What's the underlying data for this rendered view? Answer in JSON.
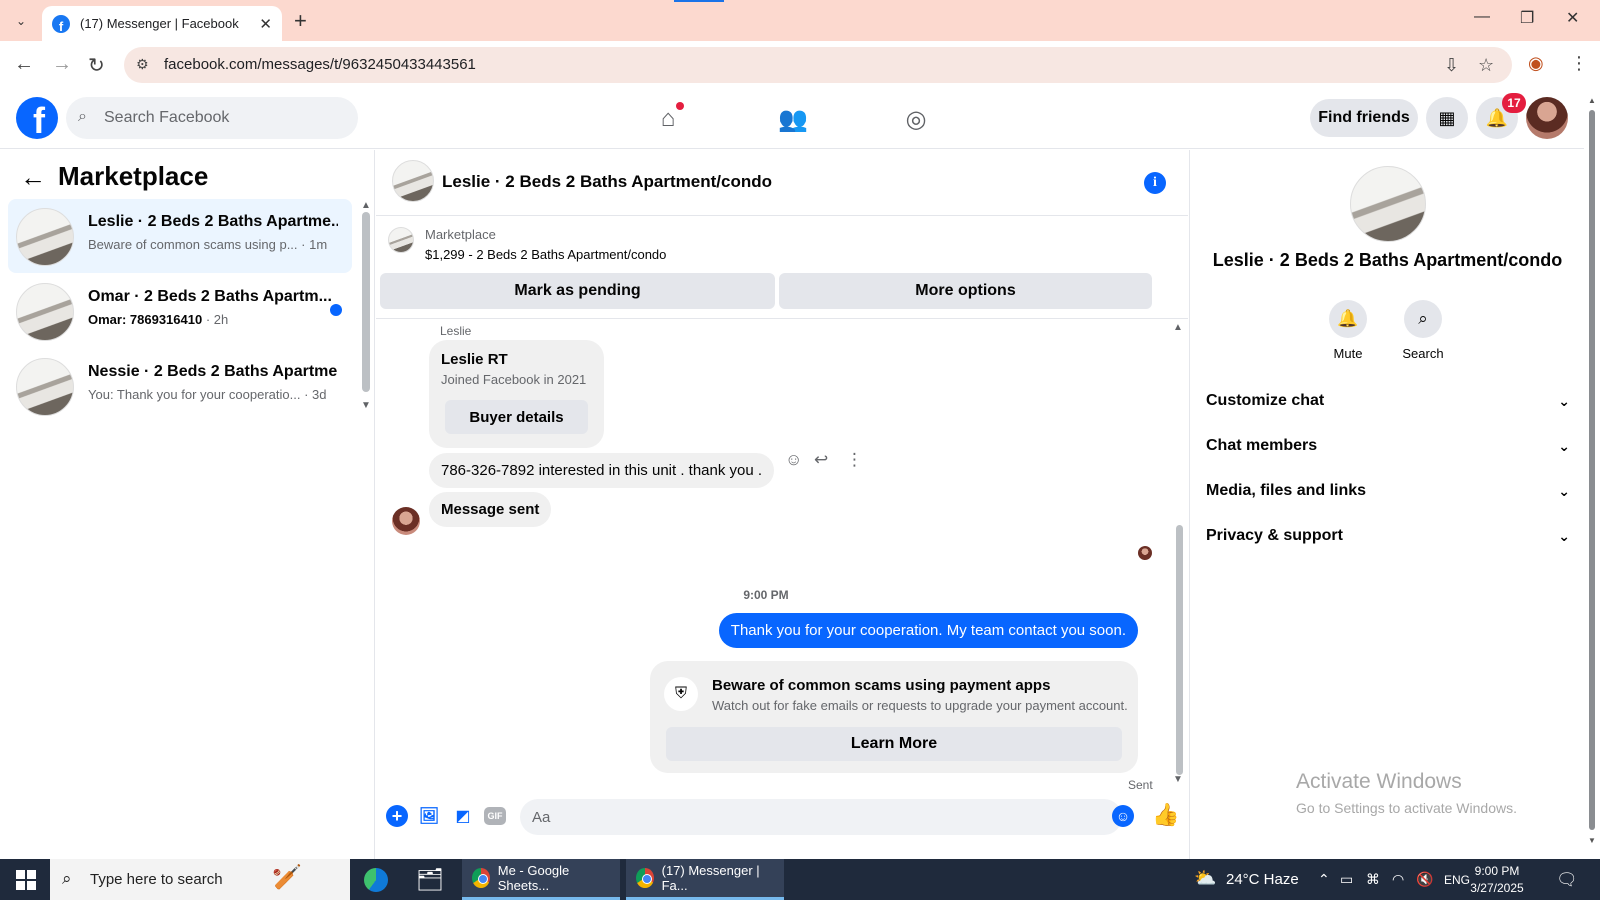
{
  "browser": {
    "tab_title": "(17) Messenger | Facebook",
    "url": "facebook.com/messages/t/9632450433443561",
    "new_tab": "+",
    "close_tab": "✕"
  },
  "header": {
    "search_placeholder": "Search Facebook",
    "find_friends": "Find friends",
    "notification_count": "17"
  },
  "left_panel": {
    "title": "Marketplace",
    "conversations": [
      {
        "name": "Leslie · 2 Beds 2 Baths Apartme...",
        "snippet": "Beware of common scams using p...",
        "time": " · 1m",
        "active": true,
        "unread": false
      },
      {
        "name": "Omar · 2 Beds 2 Baths Apartm...",
        "snippet": "Omar: 7869316410",
        "time": " · 2h",
        "active": false,
        "unread": true
      },
      {
        "name": "Nessie · 2 Beds 2 Baths Apartme...",
        "snippet": "You: Thank you for your cooperatio...",
        "time": " · 3d",
        "active": false,
        "unread": false
      }
    ]
  },
  "chat": {
    "title": "Leslie · 2 Beds 2 Baths Apartment/condo",
    "marketplace_label": "Marketplace",
    "listing": "$1,299 - 2 Beds 2 Baths Apartment/condo",
    "mark_pending": "Mark as pending",
    "more_options": "More options",
    "sender_name": "Leslie",
    "card_name": "Leslie RT",
    "card_joined": "Joined Facebook in 2021",
    "buyer_details": "Buyer details",
    "incoming_message": "786-326-7892 interested in this unit . thank you .",
    "message_sent": "Message sent",
    "timestamp": "9:00 PM",
    "outgoing_message": "Thank you for your cooperation. My team contact you soon.",
    "warning_title": "Beware of common scams using payment apps",
    "warning_desc": "Watch out for fake emails or requests to upgrade your payment account.",
    "learn_more": "Learn More",
    "sent_label": "Sent",
    "composer_placeholder": "Aa",
    "gif_label": "GIF"
  },
  "right_panel": {
    "name": "Leslie · 2 Beds 2 Baths Apartment/condo",
    "mute": "Mute",
    "search": "Search",
    "sections": [
      "Customize chat",
      "Chat members",
      "Media, files and links",
      "Privacy & support"
    ]
  },
  "watermark": {
    "line1": "Activate Windows",
    "line2": "Go to Settings to activate Windows."
  },
  "taskbar": {
    "search_placeholder": "Type here to search",
    "app_sheets": "Me - Google Sheets...",
    "app_messenger": "(17) Messenger | Fa...",
    "weather": "24°C  Haze",
    "lang": "ENG",
    "time": "9:00 PM",
    "date": "3/27/2025"
  },
  "colors": {
    "fb_blue": "#0866ff",
    "tab_strip": "#fcd9cf",
    "taskbar": "#1f2a3c"
  }
}
